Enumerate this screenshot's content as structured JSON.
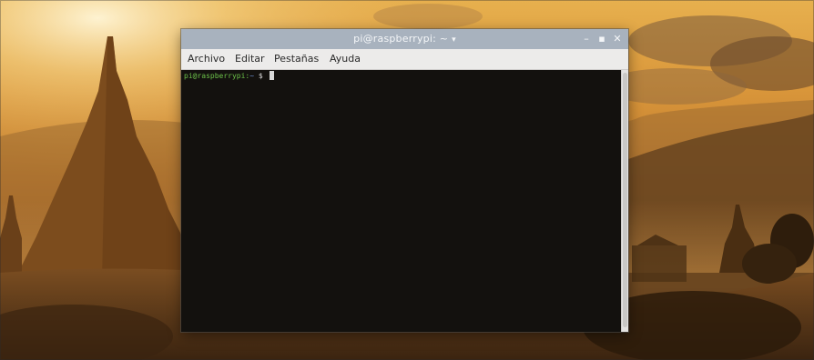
{
  "window": {
    "title": "pi@raspberrypi: ~",
    "title_arrow": "▾",
    "controls": {
      "minimize": "–",
      "maximize": "▪",
      "close": "✕"
    }
  },
  "menu": {
    "items": [
      "Archivo",
      "Editar",
      "Pestañas",
      "Ayuda"
    ]
  },
  "terminal": {
    "prompt_user": "pi@raspberrypi:",
    "prompt_path": "~",
    "prompt_symbol": "$",
    "text_color": "#6cc24a",
    "background": "#13110e"
  },
  "icons": {
    "minimize": "minimize-icon",
    "maximize": "maximize-icon",
    "close": "close-icon"
  }
}
